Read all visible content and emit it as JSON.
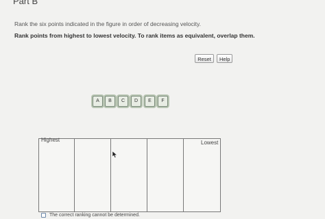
{
  "header": {
    "part_title": "Part B",
    "instruction": "Rank the six points indicated in the figure in order of decreasing velocity.",
    "instruction_bold": "Rank points from highest to lowest velocity. To rank items as equivalent, overlap them."
  },
  "toolbar": {
    "reset_label": "Reset",
    "help_label": "Help"
  },
  "tiles": [
    "A",
    "B",
    "C",
    "D",
    "E",
    "F"
  ],
  "ranking": {
    "highest_label": "Highest",
    "lowest_label": "Lowest",
    "slot_count": 5
  },
  "cannot_determine": {
    "label": "The correct ranking cannot be determined.",
    "checked": false
  },
  "icons": {
    "pointer": "mouse-pointer-icon"
  }
}
